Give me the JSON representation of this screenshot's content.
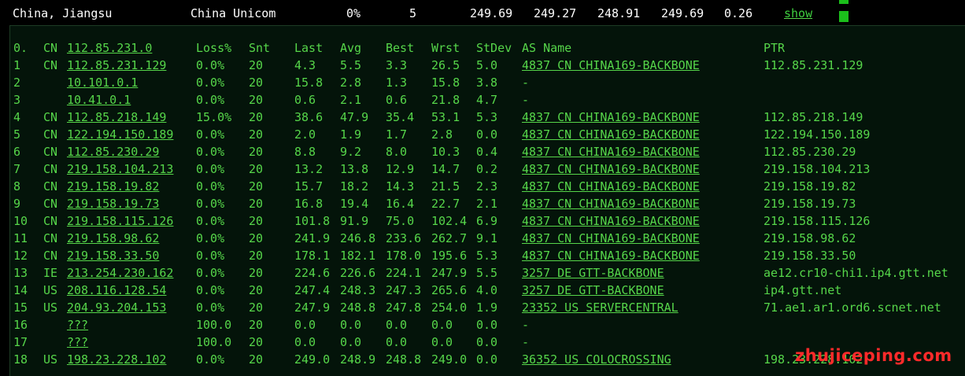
{
  "summary": {
    "location": "China, Jiangsu",
    "isp": "China Unicom",
    "loss": "0%",
    "snt": "5",
    "v1": "249.69",
    "v2": "249.27",
    "v3": "248.91",
    "v4": "249.69",
    "v5": "0.26",
    "show_label": "show"
  },
  "headers": [
    "0.",
    "CN",
    "112.85.231.0",
    "Loss%",
    "Snt",
    "Last",
    "Avg",
    "Best",
    "Wrst",
    "StDev",
    "AS Name",
    "PTR"
  ],
  "rows": [
    [
      "1",
      "CN",
      "112.85.231.129",
      "0.0%",
      "20",
      "4.3",
      "5.5",
      "3.3",
      "26.5",
      "5.0",
      "4837  CN CHINA169-BACKBONE",
      "112.85.231.129"
    ],
    [
      "2",
      "",
      "10.101.0.1",
      "0.0%",
      "20",
      "15.8",
      "2.8",
      "1.3",
      "15.8",
      "3.8",
      "-",
      ""
    ],
    [
      "3",
      "",
      "10.41.0.1",
      "0.0%",
      "20",
      "0.6",
      "2.1",
      "0.6",
      "21.8",
      "4.7",
      "-",
      ""
    ],
    [
      "4",
      "CN",
      "112.85.218.149",
      "15.0%",
      "20",
      "38.6",
      "47.9",
      "35.4",
      "53.1",
      "5.3",
      "4837  CN CHINA169-BACKBONE",
      "112.85.218.149"
    ],
    [
      "5",
      "CN",
      "122.194.150.189",
      "0.0%",
      "20",
      "2.0",
      "1.9",
      "1.7",
      "2.8",
      "0.0",
      "4837  CN CHINA169-BACKBONE",
      "122.194.150.189"
    ],
    [
      "6",
      "CN",
      "112.85.230.29",
      "0.0%",
      "20",
      "8.8",
      "9.2",
      "8.0",
      "10.3",
      "0.4",
      "4837  CN CHINA169-BACKBONE",
      "112.85.230.29"
    ],
    [
      "7",
      "CN",
      "219.158.104.213",
      "0.0%",
      "20",
      "13.2",
      "13.8",
      "12.9",
      "14.7",
      "0.2",
      "4837  CN CHINA169-BACKBONE",
      "219.158.104.213"
    ],
    [
      "8",
      "CN",
      "219.158.19.82",
      "0.0%",
      "20",
      "15.7",
      "18.2",
      "14.3",
      "21.5",
      "2.3",
      "4837  CN CHINA169-BACKBONE",
      "219.158.19.82"
    ],
    [
      "9",
      "CN",
      "219.158.19.73",
      "0.0%",
      "20",
      "16.8",
      "19.4",
      "16.4",
      "22.7",
      "2.1",
      "4837  CN CHINA169-BACKBONE",
      "219.158.19.73"
    ],
    [
      "10",
      "CN",
      "219.158.115.126",
      "0.0%",
      "20",
      "101.8",
      "91.9",
      "75.0",
      "102.4",
      "6.9",
      "4837  CN CHINA169-BACKBONE",
      "219.158.115.126"
    ],
    [
      "11",
      "CN",
      "219.158.98.62",
      "0.0%",
      "20",
      "241.9",
      "246.8",
      "233.6",
      "262.7",
      "9.1",
      "4837  CN CHINA169-BACKBONE",
      "219.158.98.62"
    ],
    [
      "12",
      "CN",
      "219.158.33.50",
      "0.0%",
      "20",
      "178.1",
      "182.1",
      "178.0",
      "195.6",
      "5.3",
      "4837  CN CHINA169-BACKBONE",
      "219.158.33.50"
    ],
    [
      "13",
      "IE",
      "213.254.230.162",
      "0.0%",
      "20",
      "224.6",
      "226.6",
      "224.1",
      "247.9",
      "5.5",
      "3257  DE GTT-BACKBONE",
      "ae12.cr10-chi1.ip4.gtt.net"
    ],
    [
      "14",
      "US",
      "208.116.128.54",
      "0.0%",
      "20",
      "247.4",
      "248.3",
      "247.3",
      "265.6",
      "4.0",
      "3257  DE GTT-BACKBONE",
      "ip4.gtt.net"
    ],
    [
      "15",
      "US",
      "204.93.204.153",
      "0.0%",
      "20",
      "247.9",
      "248.8",
      "247.8",
      "254.0",
      "1.9",
      "23352 US SERVERCENTRAL",
      "71.ae1.ar1.ord6.scnet.net"
    ],
    [
      "16",
      "",
      "???",
      "100.0",
      "20",
      "0.0",
      "0.0",
      "0.0",
      "0.0",
      "0.0",
      "-",
      ""
    ],
    [
      "17",
      "",
      "???",
      "100.0",
      "20",
      "0.0",
      "0.0",
      "0.0",
      "0.0",
      "0.0",
      "-",
      ""
    ],
    [
      "18",
      "US",
      "198.23.228.102",
      "0.0%",
      "20",
      "249.0",
      "248.9",
      "248.8",
      "249.0",
      "0.0",
      "36352 US COLOCROSSING",
      "198.23.228.102"
    ]
  ],
  "watermark": "zhujiceping.com"
}
